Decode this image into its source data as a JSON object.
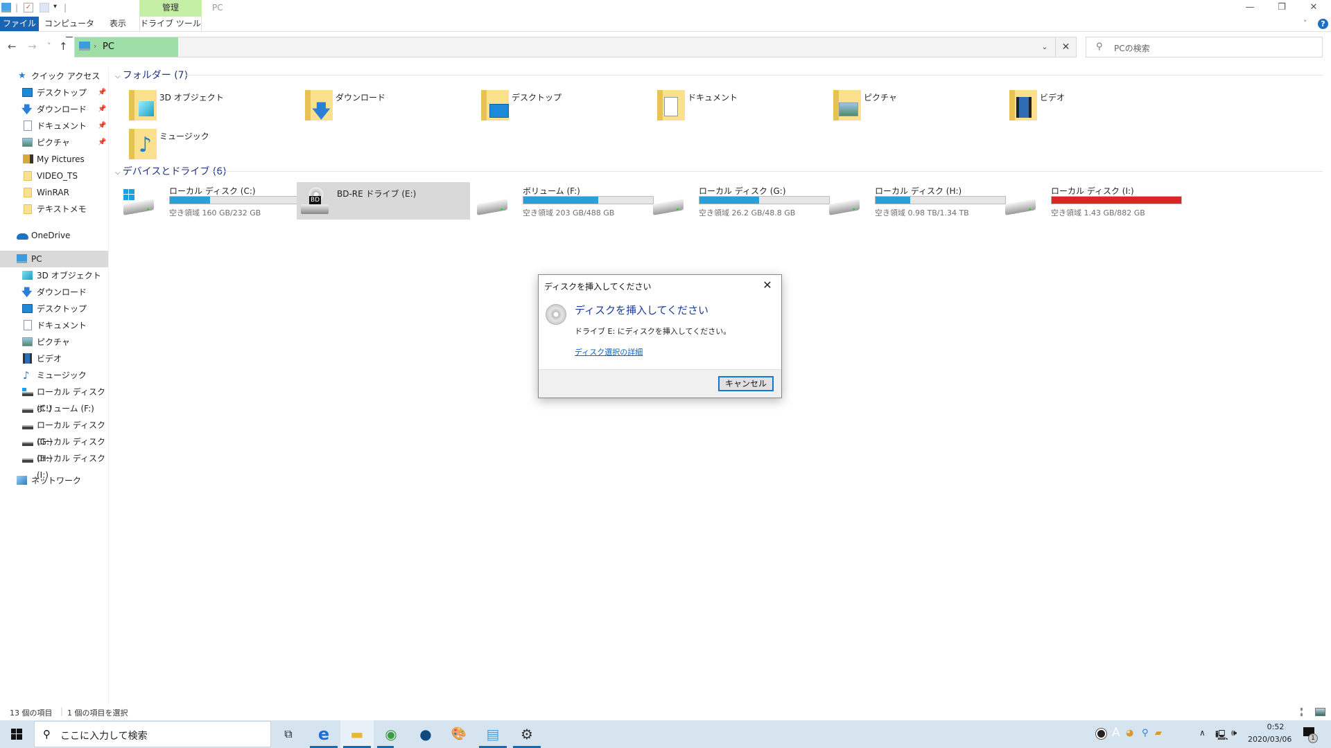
{
  "window": {
    "title": "PC",
    "context_tab_group": "管理",
    "controls": {
      "minimize": "—",
      "restore": "❐",
      "close": "✕"
    }
  },
  "ribbon": {
    "tabs": [
      {
        "label": "ファイル",
        "active": true
      },
      {
        "label": "コンピューター"
      },
      {
        "label": "表示"
      },
      {
        "label": "ドライブ ツール"
      }
    ],
    "collapse_icon": "chevron-down-icon",
    "help_icon": "?"
  },
  "nav": {
    "back": "←",
    "forward": "→",
    "recent": "˅",
    "up": "↑",
    "address_segments": [
      "PC"
    ],
    "address_separator": "›",
    "dropdown": "⌄",
    "clear": "✕",
    "search_placeholder": "PCの検索"
  },
  "sidebar": {
    "quick_access": {
      "label": "クイック アクセス",
      "items": [
        {
          "label": "デスクトップ",
          "pinned": true,
          "icon": "desktop-icon"
        },
        {
          "label": "ダウンロード",
          "pinned": true,
          "icon": "download-icon"
        },
        {
          "label": "ドキュメント",
          "pinned": true,
          "icon": "document-icon"
        },
        {
          "label": "ピクチャ",
          "pinned": true,
          "icon": "picture-icon"
        },
        {
          "label": "My Pictures",
          "icon": "video-folder-icon"
        },
        {
          "label": "VIDEO_TS",
          "icon": "folder-icon"
        },
        {
          "label": "WinRAR",
          "icon": "folder-icon"
        },
        {
          "label": "テキストメモ",
          "icon": "folder-icon"
        }
      ]
    },
    "onedrive": {
      "label": "OneDrive"
    },
    "pc": {
      "label": "PC",
      "selected": true,
      "items": [
        {
          "label": "3D オブジェクト",
          "icon": "3d-objects-icon"
        },
        {
          "label": "ダウンロード",
          "icon": "download-icon"
        },
        {
          "label": "デスクトップ",
          "icon": "desktop-icon"
        },
        {
          "label": "ドキュメント",
          "icon": "document-icon"
        },
        {
          "label": "ピクチャ",
          "icon": "picture-icon"
        },
        {
          "label": "ビデオ",
          "icon": "video-icon"
        },
        {
          "label": "ミュージック",
          "icon": "music-icon"
        },
        {
          "label": "ローカル ディスク (C:)",
          "icon": "system-drive-icon"
        },
        {
          "label": "ボリューム (F:)",
          "icon": "drive-icon"
        },
        {
          "label": "ローカル ディスク (G:)",
          "icon": "drive-icon"
        },
        {
          "label": "ローカル ディスク (H:)",
          "icon": "drive-icon"
        },
        {
          "label": "ローカル ディスク (I:)",
          "icon": "drive-icon"
        }
      ]
    },
    "network": {
      "label": "ネットワーク"
    }
  },
  "main": {
    "folders_header": "フォルダー (7)",
    "folders": [
      {
        "label": "3D オブジェクト",
        "icon": "3d-objects-icon"
      },
      {
        "label": "ダウンロード",
        "icon": "download-icon"
      },
      {
        "label": "デスクトップ",
        "icon": "desktop-icon"
      },
      {
        "label": "ドキュメント",
        "icon": "document-icon"
      },
      {
        "label": "ピクチャ",
        "icon": "picture-icon"
      },
      {
        "label": "ビデオ",
        "icon": "video-icon"
      },
      {
        "label": "ミュージック",
        "icon": "music-icon"
      }
    ],
    "drives_header": "デバイスとドライブ (6)",
    "drives": [
      {
        "name": "ローカル ディスク (C:)",
        "free": "空き領域 160 GB/232 GB",
        "used_fraction": 0.31,
        "bar_color": "#26a0da",
        "icon": "system-drive-icon"
      },
      {
        "name": "BD-RE ドライブ (E:)",
        "optical": true,
        "selected": true,
        "badge": "BD",
        "icon": "bd-drive-icon"
      },
      {
        "name": "ボリューム (F:)",
        "free": "空き領域 203 GB/488 GB",
        "used_fraction": 0.58,
        "bar_color": "#26a0da",
        "icon": "drive-icon"
      },
      {
        "name": "ローカル ディスク (G:)",
        "free": "空き領域 26.2 GB/48.8 GB",
        "used_fraction": 0.46,
        "bar_color": "#26a0da",
        "icon": "drive-icon"
      },
      {
        "name": "ローカル ディスク (H:)",
        "free": "空き領域 0.98 TB/1.34 TB",
        "used_fraction": 0.27,
        "bar_color": "#26a0da",
        "icon": "drive-icon"
      },
      {
        "name": "ローカル ディスク (I:)",
        "free": "空き領域 1.43 GB/882 GB",
        "used_fraction": 0.998,
        "bar_color": "#da2626",
        "icon": "drive-icon"
      }
    ]
  },
  "dialog": {
    "title": "ディスクを挿入してください",
    "heading": "ディスクを挿入してください",
    "message": "ドライブ E: にディスクを挿入してください。",
    "link": "ディスク選択の詳細",
    "cancel_label": "キャンセル",
    "close": "✕"
  },
  "status": {
    "item_count": "13 個の項目",
    "selected": "1 個の項目を選択"
  },
  "taskbar": {
    "search_placeholder": "ここに入力して検索",
    "apps": [
      {
        "name": "task-view",
        "glyph": "⧉"
      },
      {
        "name": "edge",
        "glyph": "e",
        "running": true
      },
      {
        "name": "file-explorer",
        "glyph": "▬",
        "running": true,
        "active": true
      },
      {
        "name": "chrome",
        "glyph": "◉",
        "running": true
      },
      {
        "name": "media-player",
        "glyph": "●"
      },
      {
        "name": "paint",
        "glyph": "🎨"
      },
      {
        "name": "notepad",
        "glyph": "▤",
        "running": true
      },
      {
        "name": "settings",
        "glyph": "⚙",
        "running": true
      }
    ],
    "tray": {
      "time": "0:52",
      "date": "2020/03/06",
      "ime": "A",
      "notifications": "1"
    }
  }
}
